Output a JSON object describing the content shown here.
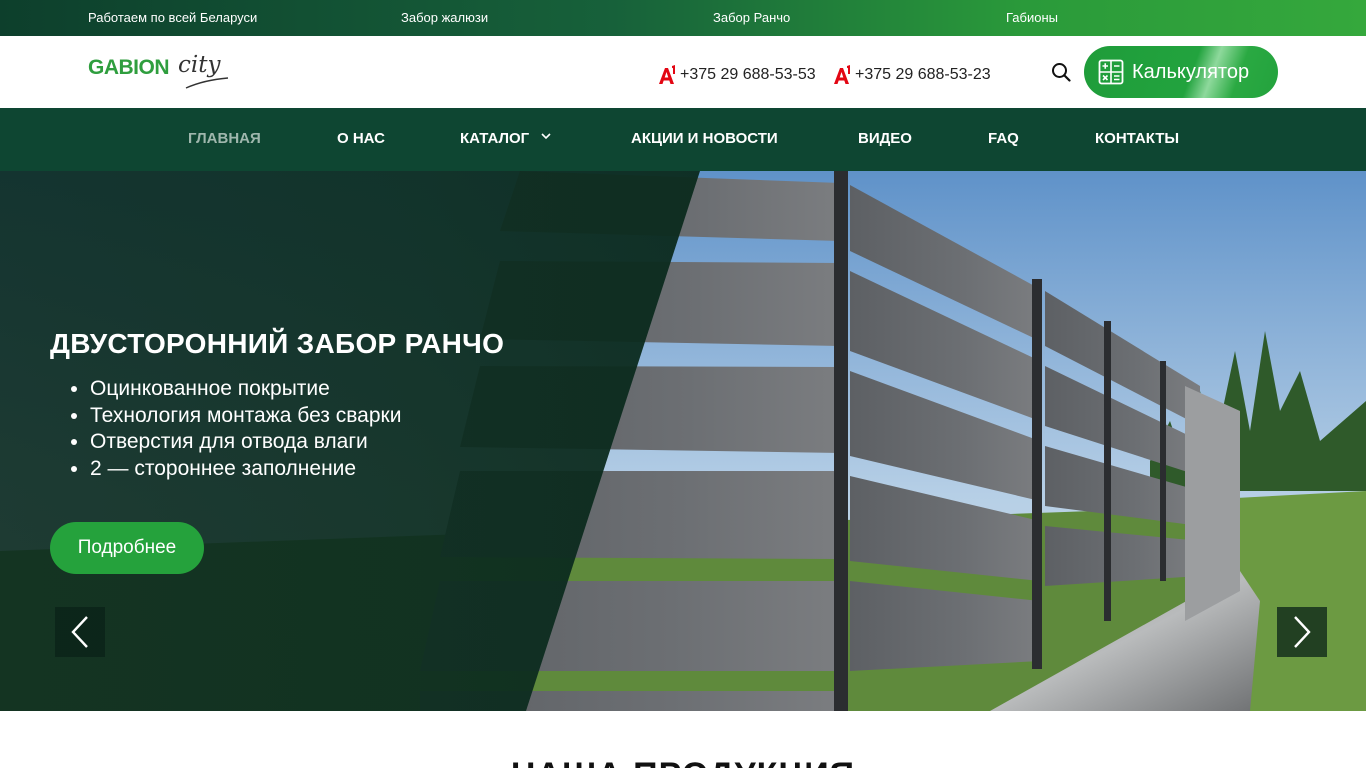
{
  "topbar": {
    "items": [
      "Работаем по всей Беларуси",
      "Забор жалюзи",
      "Забор Ранчо",
      "Габионы"
    ]
  },
  "header": {
    "logo_text": "GABION",
    "logo_script": "city",
    "phones": [
      "+375 29 688-53-53",
      "+375 29 688-53-23"
    ],
    "calculator_label": "Калькулятор"
  },
  "nav": {
    "items": [
      {
        "label": "ГЛАВНАЯ",
        "active": true
      },
      {
        "label": "О НАС"
      },
      {
        "label": "КАТАЛОГ",
        "has_dropdown": true
      },
      {
        "label": "АКЦИИ И НОВОСТИ"
      },
      {
        "label": "ВИДЕО"
      },
      {
        "label": "FAQ"
      },
      {
        "label": "КОНТАКТЫ"
      }
    ]
  },
  "hero": {
    "title": "ДВУСТОРОННИЙ ЗАБОР РАНЧО",
    "bullets": [
      "Оцинкованное покрытие",
      "Технология монтажа без сварки",
      "Отверстия для отвода влаги",
      "2 — стороннее заполнение"
    ],
    "button_label": "Подробнее"
  },
  "section": {
    "title": "НАША ПРОДУКЦИЯ"
  },
  "icons": {
    "search": "search-icon",
    "calculator": "calculator-icon",
    "operator": "a1-operator-icon",
    "prev": "chevron-left-icon",
    "next": "chevron-right-icon",
    "dropdown": "chevron-down-icon"
  },
  "colors": {
    "brand_green": "#25a23c",
    "nav_dark": "#0e4632",
    "a1_red": "#e30613"
  }
}
